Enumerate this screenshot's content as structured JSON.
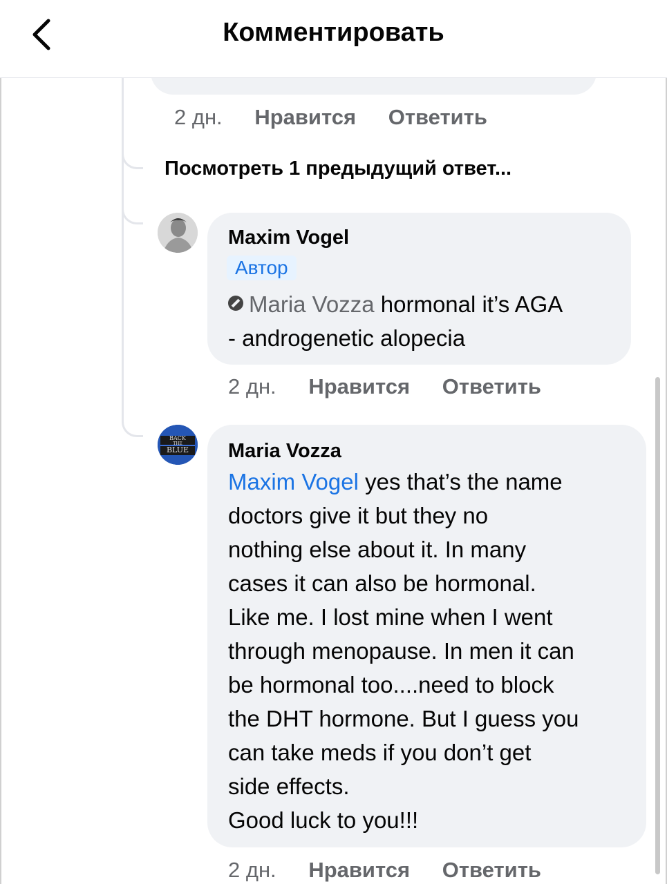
{
  "header": {
    "title": "Комментировать",
    "back_icon": "chevron-left-icon"
  },
  "actions": {
    "time": "2 дн.",
    "like": "Нравится",
    "reply": "Ответить"
  },
  "previous_replies": "Посмотреть 1 предыдущий ответ...",
  "comments": [
    {
      "author": "Maxim Vogel",
      "badge": "Автор",
      "mention": "Maria Vozza",
      "mention_icon": "no-entry-icon",
      "text_line1": " hormonal it’s AGA",
      "text_line2": "- androgenetic alopecia",
      "time": "2 дн.",
      "like": "Нравится",
      "reply": "Ответить"
    },
    {
      "author": "Maria Vozza",
      "avatar_text": [
        "BACK",
        "THE",
        "BLUE"
      ],
      "mention": "Maxim Vogel",
      "lines": [
        " yes that’s the name",
        "doctors give it but they no",
        "nothing else about it. In many",
        "cases it can also be hormonal.",
        "Like me. I lost mine when I went",
        "through menopause. In men it can",
        "be hormonal too....need to block",
        "the DHT hormone. But I guess you",
        "can take meds if you don’t get",
        "side effects.",
        "Good luck to you!!!"
      ],
      "time": "2 дн.",
      "like": "Нравится",
      "reply": "Ответить"
    }
  ]
}
